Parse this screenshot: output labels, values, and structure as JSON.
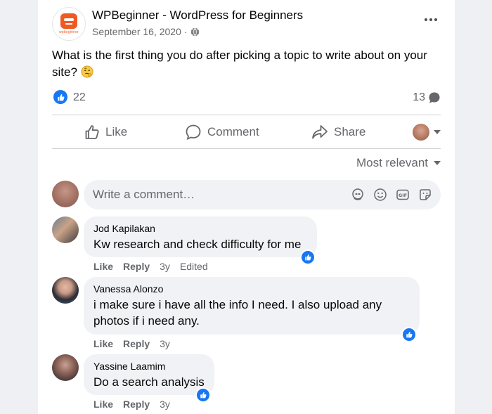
{
  "post": {
    "page_name": "WPBeginner - WordPress for Beginners",
    "avatar_caption": "wpbeginner",
    "date": "September 16, 2020",
    "separator": "·",
    "text": "What is the first thing you do after picking a topic to write about on your site?",
    "emoji_icon": "thinking-face-icon",
    "like_count": "22",
    "comment_count": "13"
  },
  "actions": {
    "like": "Like",
    "comment": "Comment",
    "share": "Share"
  },
  "sort": {
    "label": "Most relevant"
  },
  "composer": {
    "placeholder": "Write a comment…",
    "icons": [
      "avatar-sticker-icon",
      "emoji-icon",
      "gif-icon",
      "sticker-icon"
    ]
  },
  "comments": [
    {
      "author": "Jod Kapilakan",
      "text": "Kw research and check difficulty for me",
      "like": "Like",
      "reply": "Reply",
      "time": "3y",
      "edited": "Edited"
    },
    {
      "author": "Vanessa Alonzo",
      "text": "i make sure i have all the info I need. I also upload any photos if i need any.",
      "like": "Like",
      "reply": "Reply",
      "time": "3y"
    },
    {
      "author": "Yassine Laamim",
      "text": "Do a search analysis",
      "like": "Like",
      "reply": "Reply",
      "time": "3y"
    }
  ],
  "colors": {
    "accent": "#1877f2",
    "brand": "#f05a22",
    "secondary_text": "#65676b",
    "bubble": "#f0f2f5"
  }
}
